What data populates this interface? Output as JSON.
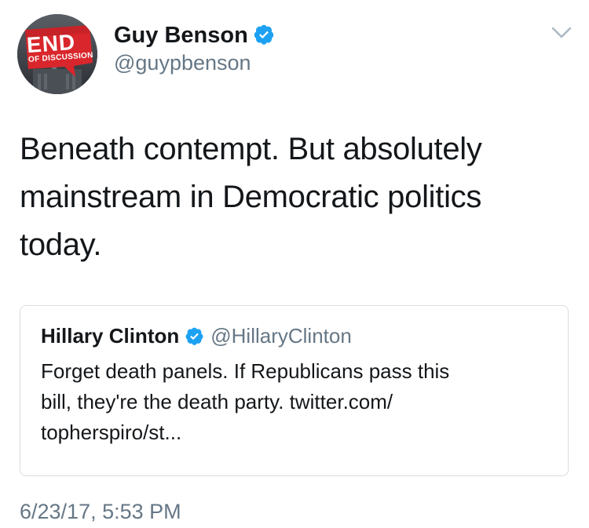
{
  "author": {
    "display_name": "Guy Benson",
    "handle": "@guypbenson",
    "avatar_text_main": "END",
    "avatar_text_sub": "OF DISCUSSION",
    "verified": true
  },
  "tweet": {
    "text_lines": [
      "Beneath contempt. But absolutely",
      "mainstream in Democratic politics",
      "today."
    ],
    "timestamp": "6/23/17, 5:53 PM"
  },
  "quoted_tweet": {
    "display_name": "Hillary Clinton",
    "handle": "@HillaryClinton",
    "verified": true,
    "text_lines": [
      "Forget death panels. If Republicans pass this",
      "bill, they're the death party. twitter.com/",
      "topherspiro/st..."
    ]
  },
  "icons": {
    "verified": "verified-badge-icon",
    "menu": "chevron-down-icon"
  },
  "colors": {
    "verified_blue": "#1da1f2",
    "secondary_text": "#657786",
    "primary_text": "#14171a",
    "border": "#d8dde1",
    "avatar_red": "#d9262c"
  }
}
